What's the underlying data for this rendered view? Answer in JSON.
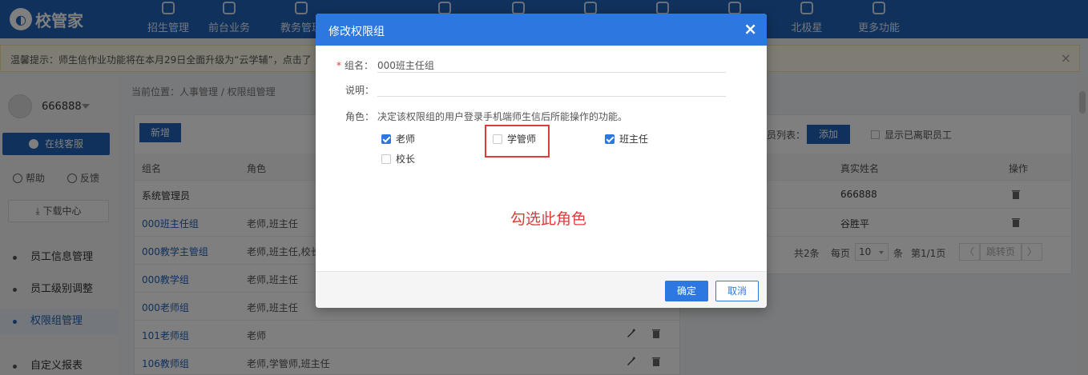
{
  "app": {
    "logo": "校管家"
  },
  "nav": [
    {
      "label": "招生管理"
    },
    {
      "label": "前台业务"
    },
    {
      "label": "教务管理"
    },
    {
      "label": ""
    },
    {
      "label": ""
    },
    {
      "label": ""
    },
    {
      "label": ""
    },
    {
      "label": ""
    },
    {
      "label": "北极星"
    },
    {
      "label": "更多功能"
    }
  ],
  "notice": {
    "text": "温馨提示：师生信作业功能将在本月29日全面升级为“云学辅”，点击了",
    "close": "×"
  },
  "sidebar": {
    "username": "666888",
    "service": "在线客服",
    "help": "帮助",
    "feedback": "反馈",
    "download": "下载中心",
    "menu": [
      {
        "label": "员工信息管理"
      },
      {
        "label": "员工级别调整"
      },
      {
        "label": "权限组管理"
      },
      {
        "label": "自定义报表"
      }
    ]
  },
  "breadcrumb": "当前位置：人事管理 / 权限组管理",
  "left_table": {
    "add": "新增",
    "headers": [
      "组名",
      "角色"
    ],
    "rows": [
      {
        "name": "系统管理员",
        "roles": ""
      },
      {
        "name": "000班主任组",
        "roles": "老师,班主任"
      },
      {
        "name": "000教学主管组",
        "roles": "老师,班主任,校长"
      },
      {
        "name": "000教学组",
        "roles": "老师,班主任"
      },
      {
        "name": "000老师组",
        "roles": "老师,班主任"
      },
      {
        "name": "101老师组",
        "roles": "老师"
      },
      {
        "name": "106教师组",
        "roles": "老师,学管师,班主任"
      }
    ]
  },
  "right_table": {
    "staff_label": "员列表：",
    "add": "添加",
    "show_left": "显示已离职员工",
    "headers": [
      "真实姓名",
      "操作"
    ],
    "rows": [
      {
        "name": "666888"
      },
      {
        "name": "谷胜平"
      }
    ],
    "pager": {
      "total": "共2条",
      "per_page": "每页",
      "size": "10",
      "unit": "条",
      "page": "第1/1页",
      "prev": "〈",
      "jump": "跳转页",
      "next": "〉"
    }
  },
  "modal": {
    "title": "修改权限组",
    "close": "×",
    "name_label": "组名：",
    "name_required": "*",
    "name_value": "000班主任组",
    "desc_label": "说明：",
    "desc_value": "",
    "role_label": "角色：",
    "role_desc": "决定该权限组的用户登录手机端师生信后所能操作的功能。",
    "roles": [
      {
        "label": "老师",
        "checked": true
      },
      {
        "label": "学管师",
        "checked": false
      },
      {
        "label": "班主任",
        "checked": true
      },
      {
        "label": "校长",
        "checked": false
      }
    ],
    "annotation": "勾选此角色",
    "ok": "确定",
    "cancel": "取消"
  },
  "colors": {
    "primary": "#2d77e0",
    "nav": "#1e62b8",
    "annotation": "#e03a3a"
  }
}
